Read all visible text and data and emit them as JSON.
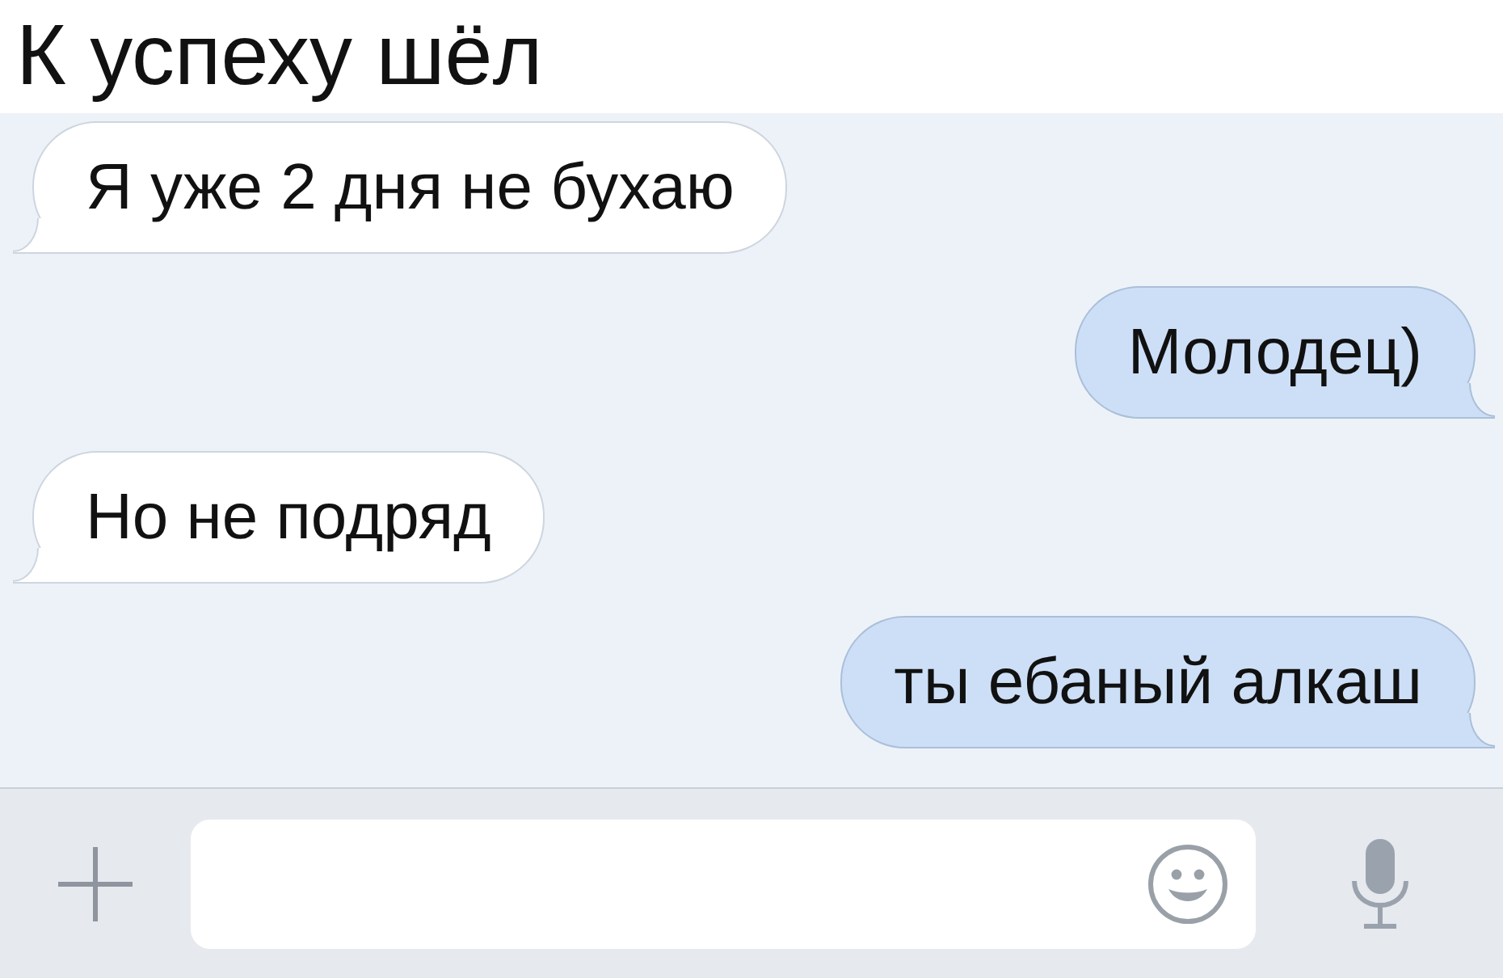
{
  "title": "К успеху шёл",
  "messages": [
    {
      "kind": "received",
      "text": "Я уже 2 дня не бухаю"
    },
    {
      "kind": "sent",
      "text": "Молодец)"
    },
    {
      "kind": "received",
      "text": "Но не подряд"
    },
    {
      "kind": "sent",
      "text": "ты ебаный алкаш"
    }
  ]
}
